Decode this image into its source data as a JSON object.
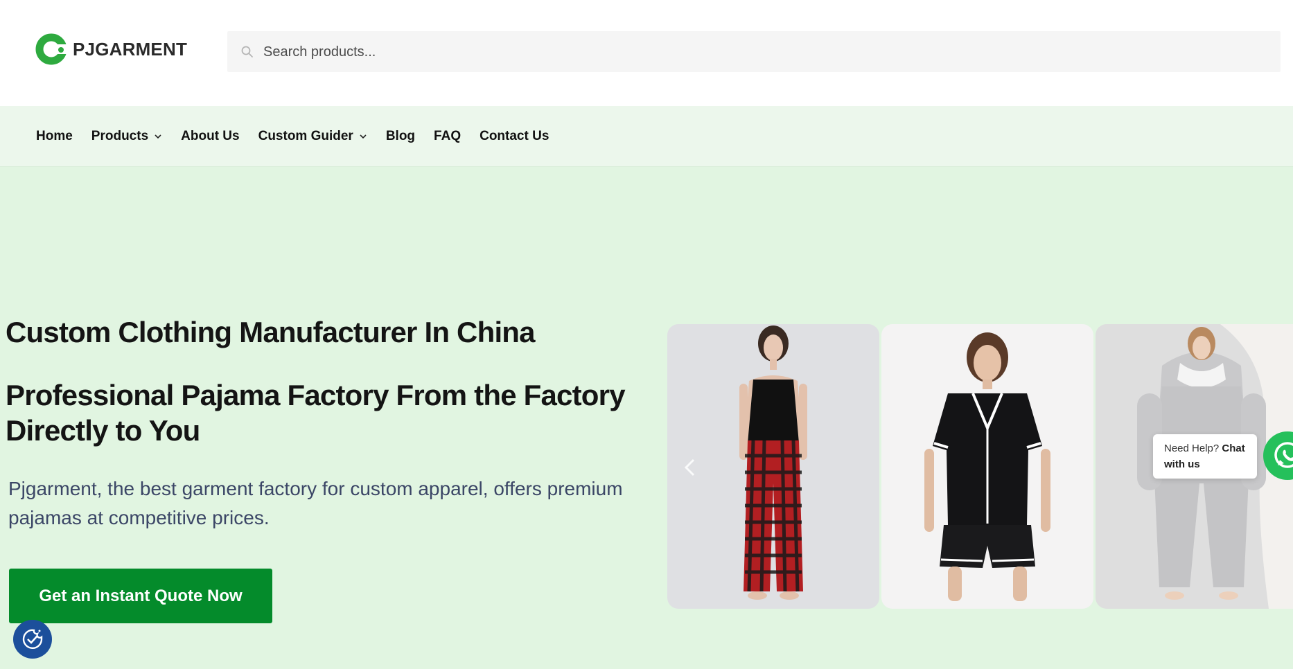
{
  "header": {
    "logo_text": "PJGARMENT",
    "search": {
      "placeholder": "Search products..."
    }
  },
  "nav": {
    "items": [
      {
        "label": "Home",
        "has_dropdown": false
      },
      {
        "label": "Products",
        "has_dropdown": true
      },
      {
        "label": "About Us",
        "has_dropdown": false
      },
      {
        "label": "Custom Guider",
        "has_dropdown": true
      },
      {
        "label": "Blog",
        "has_dropdown": false
      },
      {
        "label": "FAQ",
        "has_dropdown": false
      },
      {
        "label": "Contact Us",
        "has_dropdown": false
      }
    ]
  },
  "hero": {
    "title": "Custom Clothing Manufacturer In China",
    "subtitle": "Professional Pajama Factory From the Factory Directly to You",
    "description": "Pjgarment, the best garment factory for custom apparel, offers premium pajamas at competitive prices.",
    "cta_label": "Get an Instant Quote Now"
  },
  "carousel": {
    "slides": [
      {
        "icon": "model-camisole-plaid-pants-image"
      },
      {
        "icon": "model-black-short-pajama-set-image"
      },
      {
        "icon": "model-grey-fleece-onesie-image"
      }
    ]
  },
  "chat": {
    "prefix": "Need Help? ",
    "bold": "Chat with us"
  },
  "colors": {
    "brand_green": "#048b2b",
    "hero_bg": "#e1f5e1",
    "nav_bg": "#ecf7ec",
    "whatsapp_green": "#25c05b",
    "cookie_blue": "#1c4f9b",
    "description_text": "#3b4666"
  }
}
